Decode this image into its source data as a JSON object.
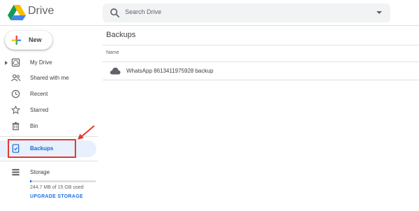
{
  "app": {
    "title": "Drive"
  },
  "search": {
    "placeholder": "Search Drive"
  },
  "new_button": {
    "label": "New"
  },
  "sidebar": {
    "items": [
      {
        "label": "My Drive",
        "icon": "my-drive-icon",
        "expandable": true
      },
      {
        "label": "Shared with me",
        "icon": "shared-icon"
      },
      {
        "label": "Recent",
        "icon": "clock-icon"
      },
      {
        "label": "Starred",
        "icon": "star-icon"
      },
      {
        "label": "Bin",
        "icon": "trash-icon"
      }
    ],
    "backups": {
      "label": "Backups",
      "icon": "backup-phone-icon",
      "active": true
    },
    "storage": {
      "label": "Storage",
      "icon": "storage-icon",
      "used_text": "244.7 MB of 15 GB used",
      "used_fraction": 0.016,
      "upgrade_label": "UPGRADE STORAGE"
    }
  },
  "main": {
    "title": "Backups",
    "column_header": "Name",
    "rows": [
      {
        "name": "WhatsApp 8613411975928 backup",
        "icon": "cloud-icon"
      }
    ]
  },
  "colors": {
    "accent": "#1a73e8",
    "active_bg": "#e8f0fe",
    "annotation_red": "#e23a2e"
  }
}
